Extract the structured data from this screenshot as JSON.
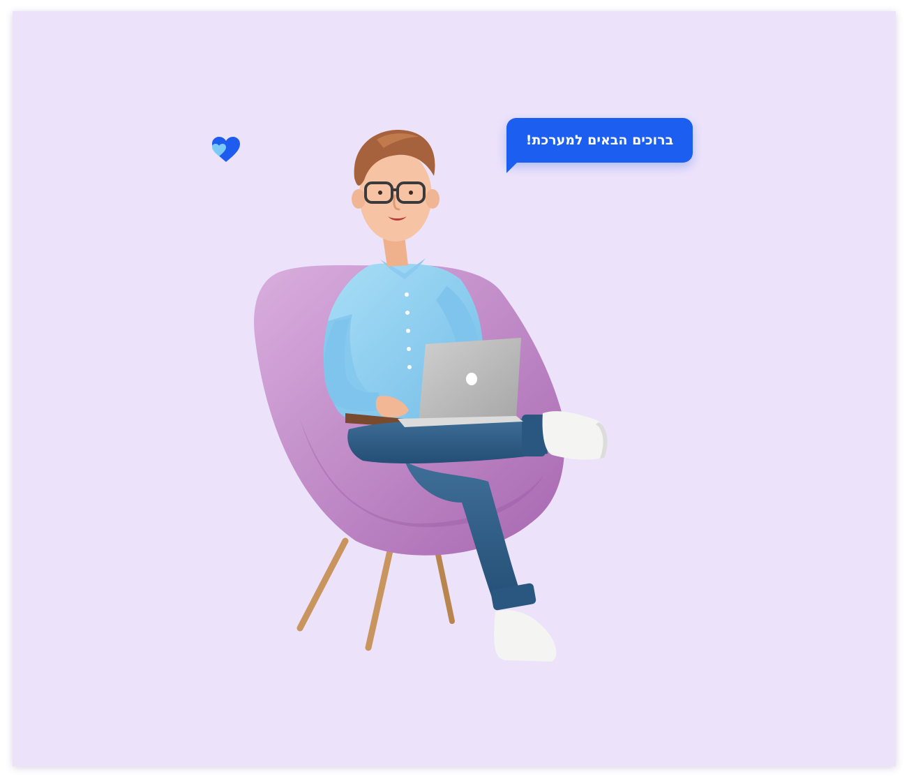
{
  "welcome_bubble": {
    "text": "ברוכים הבאים למערכת!",
    "color": "#1b5ef0"
  },
  "background": {
    "color": "#ece2fa"
  },
  "illustration": {
    "subject": "man-in-armchair-with-laptop",
    "icon": "heart-icon"
  }
}
